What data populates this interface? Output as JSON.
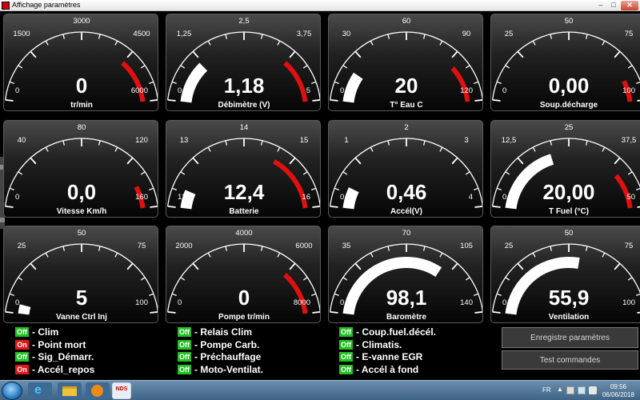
{
  "window": {
    "title": "Affichage paramètres",
    "minimize": "–",
    "maximize": "□",
    "close": "✕"
  },
  "gauges": [
    {
      "label": "tr/min",
      "value_text": "0",
      "min": 0,
      "max": 6000,
      "current": 0,
      "ticks": [
        "0",
        "1500",
        "3000",
        "4500",
        "6000"
      ],
      "redline_from": 4500
    },
    {
      "label": "Débimètre (V)",
      "value_text": "1,18",
      "min": 0,
      "max": 5,
      "current": 1.18,
      "ticks": [
        "0",
        "1,25",
        "2,5",
        "3,75",
        "5"
      ],
      "redline_from": 3.75
    },
    {
      "label": "T° Eau  C",
      "value_text": "20",
      "min": 0,
      "max": 120,
      "current": 20,
      "ticks": [
        "0",
        "30",
        "60",
        "90",
        "120"
      ],
      "redline_from": 95
    },
    {
      "label": "Soup.décharge",
      "value_text": "0,00",
      "min": 0,
      "max": 100,
      "current": 0,
      "ticks": [
        "0",
        "25",
        "50",
        "75",
        "100"
      ],
      "redline_from": 88
    },
    {
      "label": "Vitesse Km/h",
      "value_text": "0,0",
      "min": 0,
      "max": 160,
      "current": 0,
      "ticks": [
        "0",
        "40",
        "80",
        "120",
        "160"
      ],
      "redline_from": 140
    },
    {
      "label": "Batterie",
      "value_text": "12,4",
      "min": 12,
      "max": 16,
      "current": 12.4,
      "ticks": [
        "12",
        "13",
        "14",
        "15",
        "16"
      ],
      "redline_from": 14.7
    },
    {
      "label": "Accél(V)",
      "value_text": "0,46",
      "min": 0,
      "max": 4,
      "current": 0.46,
      "ticks": [
        "0",
        "1",
        "2",
        "3",
        "4"
      ],
      "redline_from": null
    },
    {
      "label": "T Fuel (°C)",
      "value_text": "20,00",
      "min": 0,
      "max": 50,
      "current": 20,
      "ticks": [
        "0",
        "12,5",
        "25",
        "37,5",
        "50"
      ],
      "redline_from": 40
    },
    {
      "label": "Vanne Ctrl Inj",
      "value_text": "5",
      "min": 0,
      "max": 100,
      "current": 5,
      "ticks": [
        "0",
        "25",
        "50",
        "75",
        "100"
      ],
      "redline_from": null
    },
    {
      "label": "Pompe tr/min",
      "value_text": "0",
      "min": 0,
      "max": 8000,
      "current": 0,
      "ticks": [
        "0",
        "2000",
        "4000",
        "6000",
        "8000"
      ],
      "redline_from": 6000
    },
    {
      "label": "Baromètre",
      "value_text": "98,1",
      "min": 0,
      "max": 140,
      "current": 98.1,
      "ticks": [
        "0",
        "35",
        "70",
        "105",
        "140"
      ],
      "redline_from": null
    },
    {
      "label": "Ventilation",
      "value_text": "55,9",
      "min": 0,
      "max": 100,
      "current": 55.9,
      "ticks": [
        "0",
        "25",
        "50",
        "75",
        "100"
      ],
      "redline_from": null
    }
  ],
  "indicators": [
    {
      "state": "Off",
      "on": false,
      "label": "- Clim"
    },
    {
      "state": "On",
      "on": true,
      "label": "- Point mort"
    },
    {
      "state": "Off",
      "on": false,
      "label": "- Sig_Démarr."
    },
    {
      "state": "On",
      "on": true,
      "label": "- Accél_repos"
    },
    {
      "state": "Off",
      "on": false,
      "label": "- Relais Clim"
    },
    {
      "state": "Off",
      "on": false,
      "label": "- Pompe Carb."
    },
    {
      "state": "Off",
      "on": false,
      "label": "- Préchauffage"
    },
    {
      "state": "Off",
      "on": false,
      "label": "- Moto-Ventilat."
    },
    {
      "state": "Off",
      "on": false,
      "label": "- Coup.fuel.décél."
    },
    {
      "state": "Off",
      "on": false,
      "label": "- Climatis."
    },
    {
      "state": "Off",
      "on": false,
      "label": "- E-vanne EGR"
    },
    {
      "state": "Off",
      "on": false,
      "label": "- Accél à fond"
    }
  ],
  "buttons": {
    "save": "Enregistre paramètres",
    "test": "Test commandes"
  },
  "taskbar": {
    "app_label": "NDS",
    "lang": "FR",
    "time": "09:56",
    "date": "06/06/2018"
  },
  "colors": {
    "needle_fill": "#ffffff",
    "redline": "#e01010",
    "off": "#22c022",
    "on": "#e01818"
  }
}
